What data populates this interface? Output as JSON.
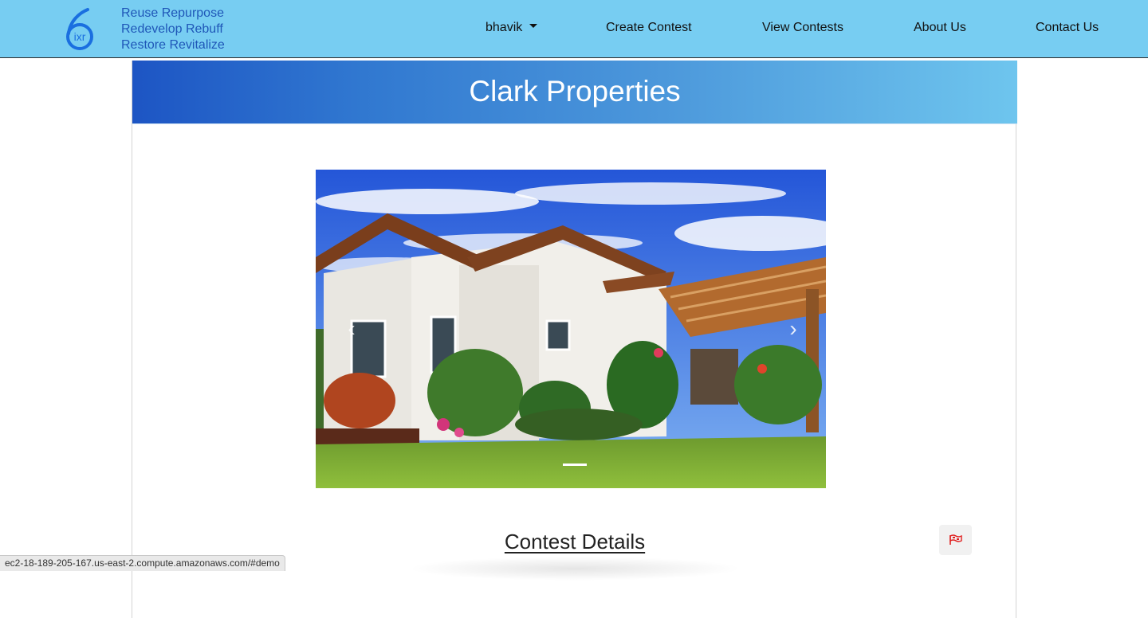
{
  "brand": {
    "logo_digit": "6",
    "logo_letters": "ixr",
    "tagline": [
      "Reuse   Repurpose",
      "Redevelop   Rebuff",
      "Restore  Revitalize"
    ]
  },
  "nav": {
    "user": "bhavik",
    "items": [
      "Create Contest",
      "View Contests",
      "About Us",
      "Contact Us"
    ]
  },
  "page": {
    "title": "Clark Properties",
    "section_title": "Contest Details"
  },
  "carousel": {
    "prev_icon": "chevron-left",
    "next_icon": "chevron-right",
    "slide_count": 1,
    "active_index": 0
  },
  "statusbar": {
    "url": "ec2-18-189-205-167.us-east-2.compute.amazonaws.com/#demo"
  },
  "colors": {
    "navbar": "#77cdf2",
    "brand_blue": "#1f57b8",
    "banner_start": "#1d55c4",
    "banner_end": "#6ec5ee",
    "flag_red": "#e02020"
  }
}
